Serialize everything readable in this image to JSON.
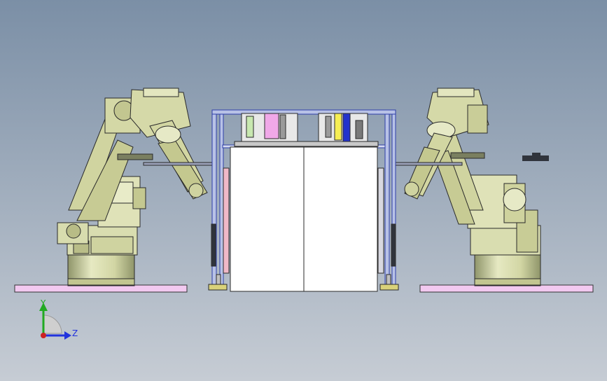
{
  "triad": {
    "y_label": "Y",
    "z_label": "Z"
  },
  "colors": {
    "bg_top": "#7a8fa6",
    "bg_bottom": "#c4cad2",
    "robot_body": "#d8dcae",
    "robot_shadow": "#9aa06a",
    "robot_outline": "#2c2c2c",
    "plate": "#f0c8f0",
    "cabinet": "#ffffff",
    "frame_blue": "#2e3fa8",
    "axis_y": "#22aa22",
    "axis_z": "#2233dd",
    "origin": "#cc2222"
  },
  "parts": [
    "left-robot",
    "right-robot",
    "center-cabinet",
    "left-base-plate",
    "right-base-plate"
  ]
}
